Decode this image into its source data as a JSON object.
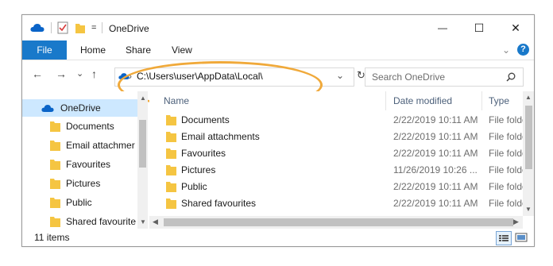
{
  "window": {
    "title": "OneDrive",
    "qat_dropdown": "=",
    "controls": {
      "minimize": "—",
      "maximize": "☐",
      "close": "✕"
    }
  },
  "ribbon": {
    "file": "File",
    "tabs": [
      "Home",
      "Share",
      "View"
    ],
    "expand_chevron": "⌄",
    "help": "?"
  },
  "address": {
    "back": "←",
    "forward": "→",
    "recent": "⌄",
    "up": "↑",
    "breadcrumb_sep": "›",
    "path": "C:\\Users\\user\\AppData\\Local\\",
    "dropdown": "⌄",
    "refresh": "↻",
    "highlight_color": "#f0a93a"
  },
  "search": {
    "placeholder": "Search OneDrive",
    "icon": "search-icon"
  },
  "nav": {
    "items": [
      {
        "label": "OneDrive",
        "icon": "onedrive-cloud-icon",
        "selected": true
      },
      {
        "label": "Documents",
        "icon": "folder-icon"
      },
      {
        "label": "Email attachmer",
        "icon": "folder-icon"
      },
      {
        "label": "Favourites",
        "icon": "folder-icon"
      },
      {
        "label": "Pictures",
        "icon": "folder-icon"
      },
      {
        "label": "Public",
        "icon": "folder-icon"
      },
      {
        "label": "Shared favourite",
        "icon": "folder-icon"
      }
    ]
  },
  "columns": {
    "name": "Name",
    "date": "Date modified",
    "type": "Type"
  },
  "files": [
    {
      "name": "Documents",
      "date": "2/22/2019 10:11 AM",
      "type": "File folder"
    },
    {
      "name": "Email attachments",
      "date": "2/22/2019 10:11 AM",
      "type": "File folder"
    },
    {
      "name": "Favourites",
      "date": "2/22/2019 10:11 AM",
      "type": "File folder"
    },
    {
      "name": "Pictures",
      "date": "11/26/2019 10:26 ...",
      "type": "File folder"
    },
    {
      "name": "Public",
      "date": "2/22/2019 10:11 AM",
      "type": "File folder"
    },
    {
      "name": "Shared favourites",
      "date": "2/22/2019 10:11 AM",
      "type": "File folder"
    }
  ],
  "status": {
    "item_count": "11 items"
  },
  "colors": {
    "accent": "#1979ca",
    "selection": "#cde8ff",
    "folder": "#f5c542",
    "onedrive": "#0a64c8"
  }
}
